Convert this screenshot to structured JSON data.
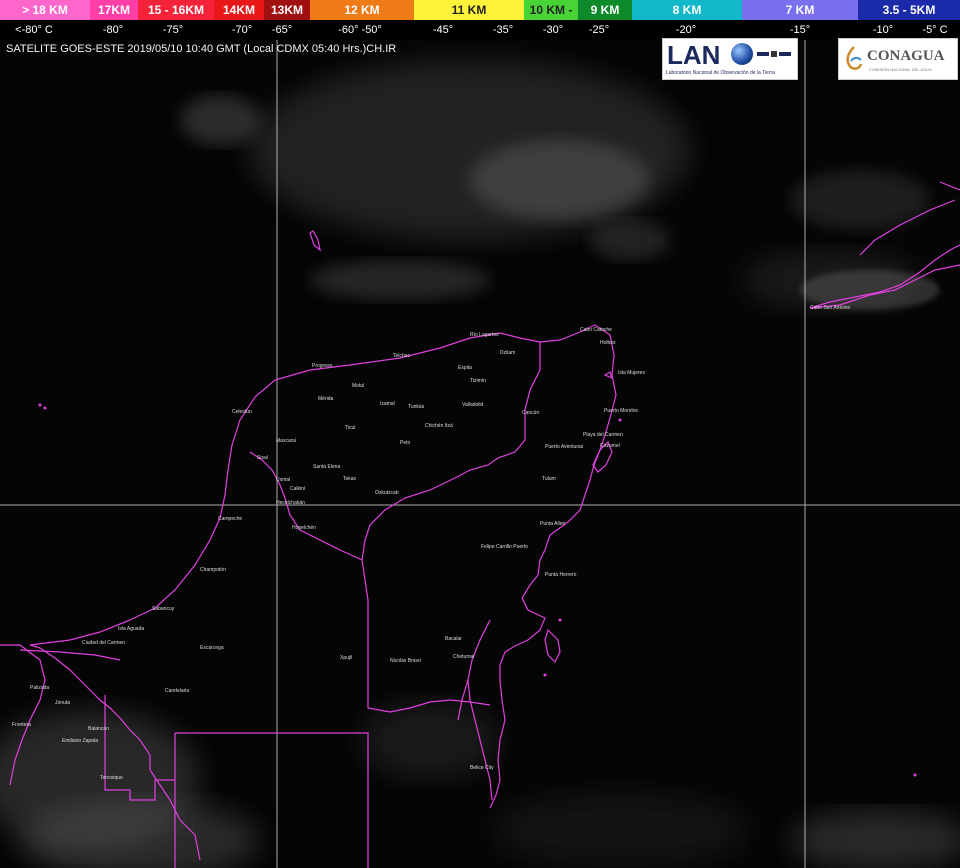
{
  "legend": {
    "segments": [
      {
        "label": "> 18 KM",
        "color": "#ff66cc"
      },
      {
        "label": "17KM",
        "color": "#ff3fa8"
      },
      {
        "label": "15 - 16KM",
        "color": "#f5233a"
      },
      {
        "label": "14KM",
        "color": "#e81818"
      },
      {
        "label": "13KM",
        "color": "#a01010"
      },
      {
        "label": "12 KM",
        "color": "#ee7a18"
      },
      {
        "label": "11 KM",
        "color": "#fff23a"
      },
      {
        "label": "10 KM -",
        "color": "#48d436"
      },
      {
        "label": "9 KM",
        "color": "#0e8a2a"
      },
      {
        "label": "8 KM",
        "color": "#10b8c8"
      },
      {
        "label": "7 KM",
        "color": "#7a70ee"
      },
      {
        "label": "3.5 - 5KM",
        "color": "#1a2aa8"
      }
    ],
    "ticks": [
      "<-80° C",
      "-80°",
      "-75°",
      "-70°",
      "-65°",
      "-60° -50°",
      "-45°",
      "-35°",
      "-30°",
      "-25°",
      "-20°",
      "-15°",
      "-10°",
      "-5° C"
    ]
  },
  "caption": "SATELITE GOES-ESTE 2019/05/10 10:40 GMT (Local CDMX 05:40 Hrs.)CH.IR",
  "logos": {
    "lano": {
      "title": "LAN",
      "subtitle": "Laboratorio Nacional de Observación de la Tierra"
    },
    "conagua": {
      "title": "CONAGUA",
      "subtitle": "COMISIÓN NACIONAL DEL AGUA"
    }
  },
  "colors": {
    "border": "#e040e0",
    "grid": "#d8d8d8",
    "background": "#050505"
  },
  "towns": [
    {
      "name": "Río Lagartos"
    },
    {
      "name": "Dzilam"
    },
    {
      "name": "Progreso"
    },
    {
      "name": "Telchac"
    },
    {
      "name": "Motul"
    },
    {
      "name": "Mérida"
    },
    {
      "name": "Izamal"
    },
    {
      "name": "Tunkás"
    },
    {
      "name": "Espita"
    },
    {
      "name": "Tizimín"
    },
    {
      "name": "Cancún"
    },
    {
      "name": "Isla Mujeres"
    },
    {
      "name": "Valladolid"
    },
    {
      "name": "Chichén Itzá"
    },
    {
      "name": "Tulum"
    },
    {
      "name": "Playa del Carmen"
    },
    {
      "name": "Cozumel"
    },
    {
      "name": "Puerto Aventuras"
    },
    {
      "name": "Puerto Morelos"
    },
    {
      "name": "Ticul"
    },
    {
      "name": "Peto"
    },
    {
      "name": "Tekax"
    },
    {
      "name": "Oxkutzcab"
    },
    {
      "name": "Campeche"
    },
    {
      "name": "Champotón"
    },
    {
      "name": "Escárcega"
    },
    {
      "name": "Hopelchén"
    },
    {
      "name": "Xpujil"
    },
    {
      "name": "Nicolás Bravo"
    },
    {
      "name": "Bacalar"
    },
    {
      "name": "Chetumal"
    },
    {
      "name": "Felipe Carrillo Puerto"
    },
    {
      "name": "Punta Herrero"
    },
    {
      "name": "Punta Allen"
    },
    {
      "name": "Ciudad del Carmen"
    },
    {
      "name": "Isla Aguada"
    },
    {
      "name": "Sabancuy"
    },
    {
      "name": "Palizada"
    },
    {
      "name": "Candelaria"
    },
    {
      "name": "Tenosique"
    },
    {
      "name": "Balancán"
    },
    {
      "name": "Emiliano Zapata"
    },
    {
      "name": "Frontera"
    },
    {
      "name": "Jonuta"
    },
    {
      "name": "Belice City"
    },
    {
      "name": "Cabo Catoche"
    },
    {
      "name": "Holbox"
    },
    {
      "name": "Celestún"
    },
    {
      "name": "Uxmal"
    },
    {
      "name": "Santa Elena"
    },
    {
      "name": "Maxcanú"
    },
    {
      "name": "Calkiní"
    },
    {
      "name": "Hecelchakán"
    },
    {
      "name": "Sisal"
    },
    {
      "name": "Cabo San Antonio"
    }
  ]
}
